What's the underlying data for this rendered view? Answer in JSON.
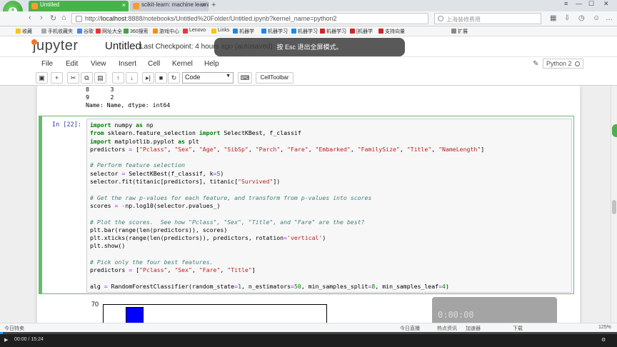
{
  "browser": {
    "tabs": [
      {
        "label": "Untitled",
        "active": true
      },
      {
        "label": "scikit-learn: machine learning",
        "active": false
      }
    ],
    "url_prefix": "http://",
    "url_host": "localhost",
    "url_rest": ":8888/notebooks/Untitled%20Folder/Untitled.ipynb?kernel_name=python2",
    "search_placeholder": "上海装修费用",
    "bookmarks": [
      "收藏",
      "手机收藏夹",
      "谷歌",
      "网址大全",
      "360搜索",
      "游戏中心",
      "Lenovo",
      "Links",
      "机器学",
      "机器学习",
      "机器学习",
      "机器学习",
      "[机器学",
      "支持向量",
      "扩展"
    ],
    "accent_color": "#48b34a"
  },
  "jupyter": {
    "logo_text": "jupyter",
    "notebook_title": "Untitled",
    "checkpoint": "Last Checkpoint: 4 hours ago (autosaved)",
    "fullscreen_hint": "按 Esc 退出全屏模式。",
    "menu": [
      "File",
      "Edit",
      "View",
      "Insert",
      "Cell",
      "Kernel",
      "Help"
    ],
    "kernel_name": "Python 2",
    "cell_type": "Code",
    "celltoolbar_label": "CellToolbar"
  },
  "notebook": {
    "previous_output": "8      3\n9      2\nName: Name, dtype: int64",
    "cell_prompt": "In [22]:",
    "plot_ytick": "70"
  },
  "statusbar": {
    "left": "今日特卖",
    "items": [
      "今日直播",
      "热点资讯",
      "加速器",
      "下载"
    ],
    "zoom": "125%"
  },
  "player": {
    "time": "00:00 / 15:24",
    "overlay_time": "0:00:00"
  }
}
